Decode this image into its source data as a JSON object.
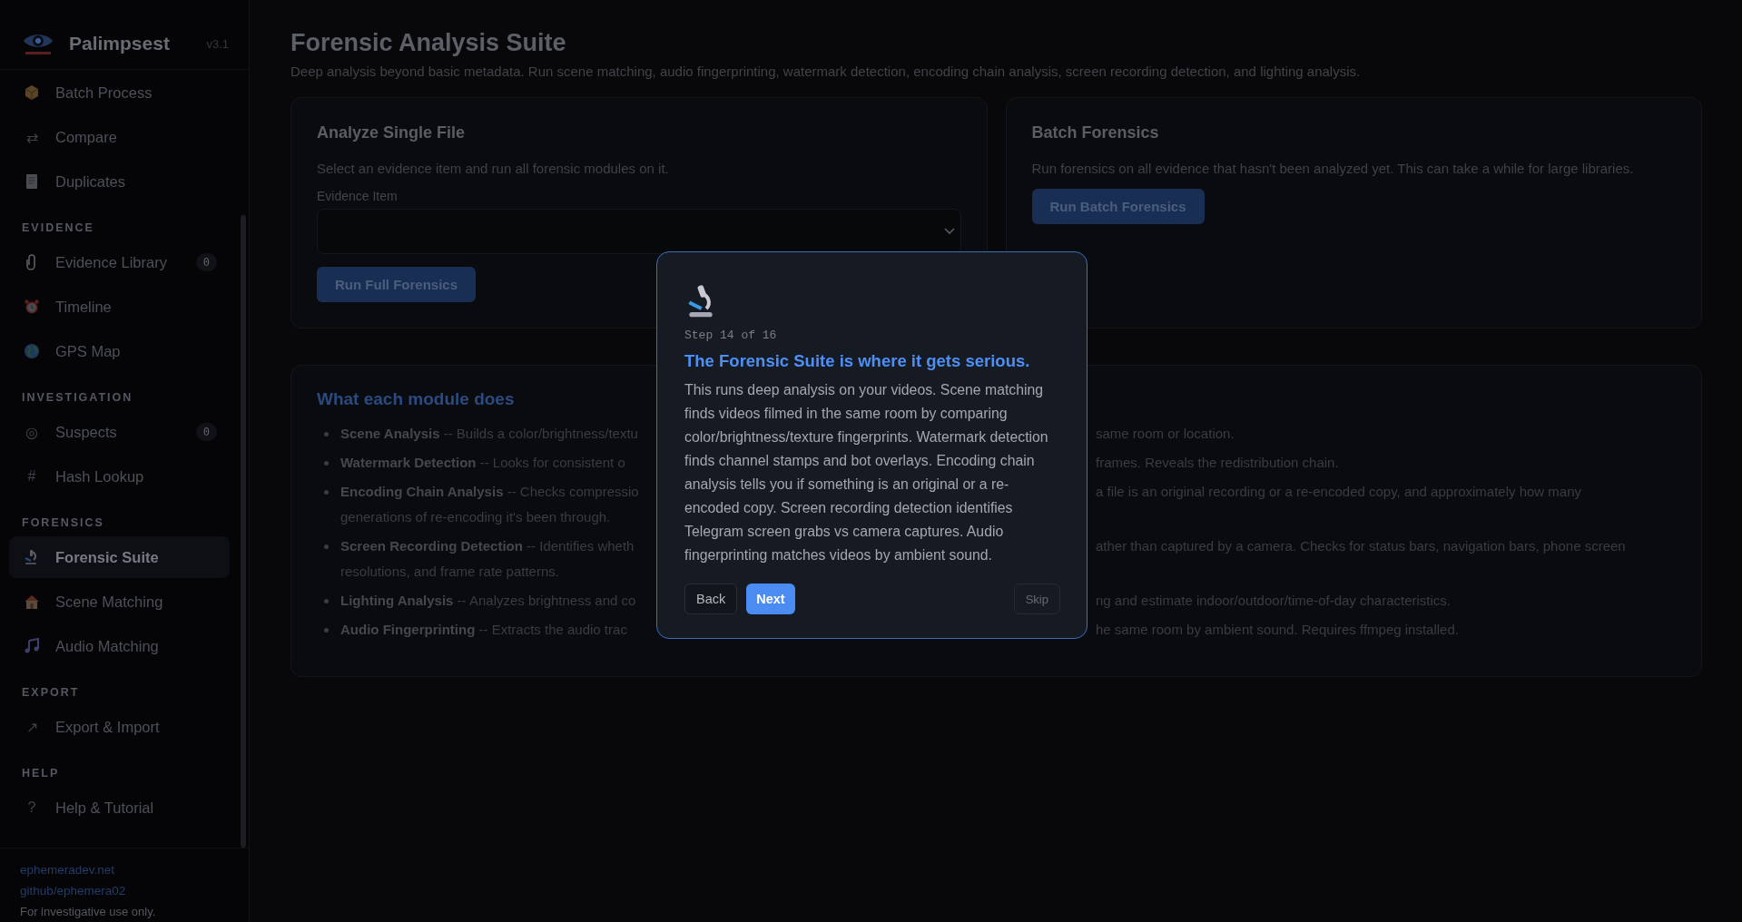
{
  "sidebar": {
    "brand": "Palimpsest",
    "version": "v3.1",
    "sections": [
      {
        "items": [
          {
            "label": "Batch Process",
            "kind": "picture",
            "selected": false
          },
          {
            "label": "Compare",
            "kind": "glyph",
            "glyph": "⇄",
            "selected": false
          },
          {
            "label": "Duplicates",
            "kind": "picture",
            "selected": false
          }
        ]
      },
      {
        "heading": "EVIDENCE",
        "items": [
          {
            "label": "Evidence Library",
            "kind": "picture",
            "badge": "0",
            "selected": false
          },
          {
            "label": "Timeline",
            "kind": "picture",
            "selected": false
          },
          {
            "label": "GPS Map",
            "kind": "picture",
            "selected": false
          }
        ]
      },
      {
        "heading": "INVESTIGATION",
        "items": [
          {
            "label": "Suspects",
            "kind": "glyph",
            "glyph": "◎",
            "badge": "0",
            "selected": false
          },
          {
            "label": "Hash Lookup",
            "kind": "glyph",
            "glyph": "#",
            "selected": false
          }
        ]
      },
      {
        "heading": "FORENSICS",
        "items": [
          {
            "label": "Forensic Suite",
            "kind": "picture",
            "selected": true
          },
          {
            "label": "Scene Matching",
            "kind": "picture",
            "selected": false
          },
          {
            "label": "Audio Matching",
            "kind": "picture",
            "selected": false
          }
        ]
      },
      {
        "heading": "EXPORT",
        "items": [
          {
            "label": "Export & Import",
            "kind": "glyph",
            "glyph": "↗",
            "selected": false
          }
        ]
      },
      {
        "heading": "HELP",
        "items": [
          {
            "label": "Help & Tutorial",
            "kind": "glyph",
            "glyph": "?",
            "selected": false
          }
        ]
      }
    ],
    "links": [
      "ephemeradev.net",
      "github/ephemera02"
    ],
    "footer": "For investigative use only."
  },
  "page": {
    "title": "Forensic Analysis Suite",
    "subtitle": "Deep analysis beyond basic metadata. Run scene matching, audio fingerprinting, watermark detection, encoding chain analysis, screen recording detection, and lighting analysis."
  },
  "single_file_card": {
    "title": "Analyze Single File",
    "description": "Select an evidence item and run all forensic modules on it.",
    "field_label": "Evidence Item",
    "button": "Run Full Forensics"
  },
  "batch_card": {
    "title": "Batch Forensics",
    "description": "Run forensics on all evidence that hasn't been analyzed yet. This can take a while for large libraries.",
    "button": "Run Batch Forensics"
  },
  "modules_card": {
    "title": "What each module does",
    "items": [
      {
        "left": "**Scene Analysis** -- Builds a color/brightness/textu",
        "right": "same room or location."
      },
      {
        "left": "**Watermark Detection** -- Looks for consistent o",
        "right": "frames. Reveals the redistribution chain."
      },
      {
        "left": "**Encoding Chain Analysis** -- Checks compressio",
        "right": "a file is an original recording or a re-encoded copy, and approximately how many",
        "continuation": "generations of re-encoding it's been through."
      },
      {
        "left": "**Screen Recording Detection** -- Identifies wheth",
        "right": "ather than captured by a camera. Checks for status bars, navigation bars, phone screen",
        "continuation": "resolutions, and frame rate patterns."
      },
      {
        "left": "**Lighting Analysis** -- Analyzes brightness and co",
        "right": "ng and estimate indoor/outdoor/time-of-day characteristics."
      },
      {
        "left": "**Audio Fingerprinting** -- Extracts the audio trac",
        "right": "he same room by ambient sound. Requires ffmpeg installed."
      }
    ]
  },
  "tour_dialog": {
    "step": "Step 14 of 16",
    "title": "The Forensic Suite is where it gets serious.",
    "body": "This runs deep analysis on your videos. Scene matching finds videos filmed in the same room by comparing color/brightness/texture fingerprints. Watermark detection finds channel stamps and bot overlays. Encoding chain analysis tells you if something is an original or a re-encoded copy. Screen recording detection identifies Telegram screen grabs vs camera captures. Audio fingerprinting matches videos by ambient sound.",
    "buttons": [
      {
        "label": "Back",
        "kind": "secondary"
      },
      {
        "label": "Next",
        "kind": "primary"
      },
      {
        "label": "Skip",
        "kind": "skip"
      }
    ]
  }
}
